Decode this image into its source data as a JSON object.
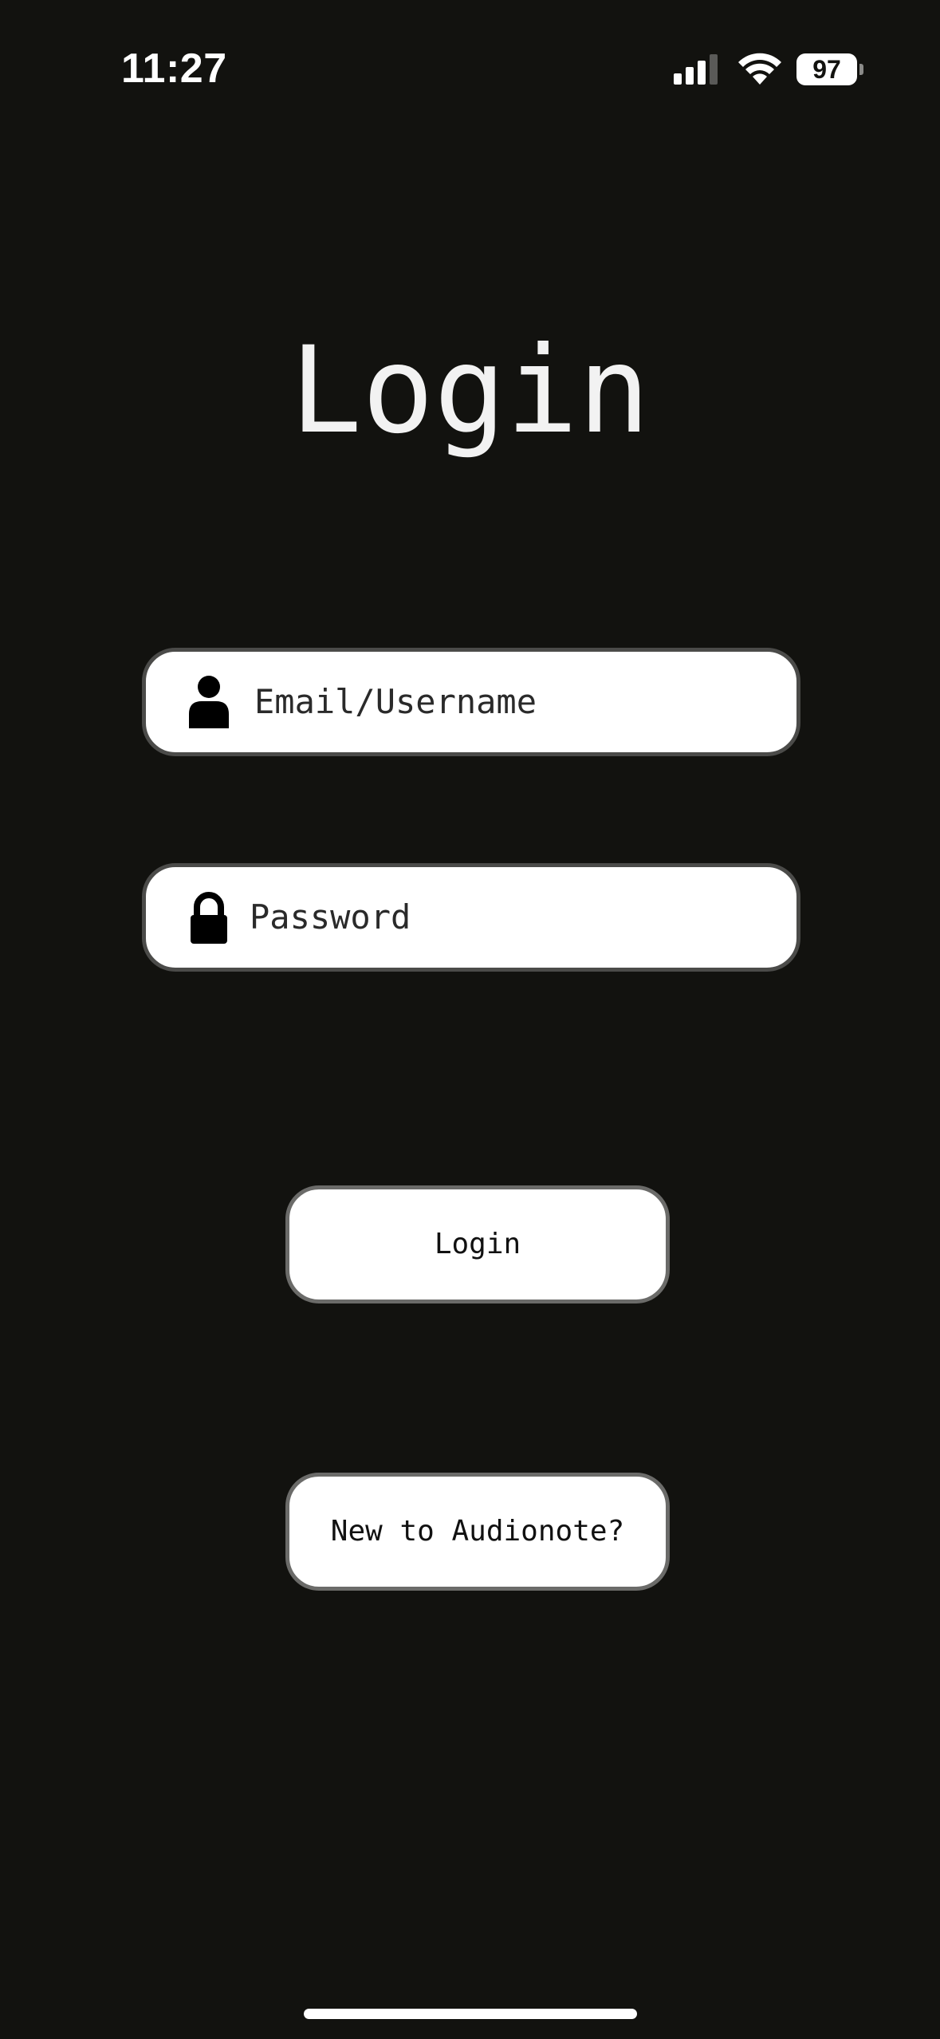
{
  "status_bar": {
    "time": "11:27",
    "battery": "97",
    "icons": [
      "signal-icon",
      "wifi-icon",
      "battery-icon"
    ]
  },
  "page": {
    "title": "Login"
  },
  "form": {
    "email": {
      "placeholder": "Email/Username",
      "icon": "user-icon"
    },
    "password": {
      "placeholder": "Password",
      "icon": "lock-icon"
    }
  },
  "buttons": {
    "login_label": "Login",
    "signup_label": "New to Audionote?"
  },
  "colors": {
    "background": "#12120f",
    "surface": "#ffffff",
    "title": "#f2f2f2"
  }
}
